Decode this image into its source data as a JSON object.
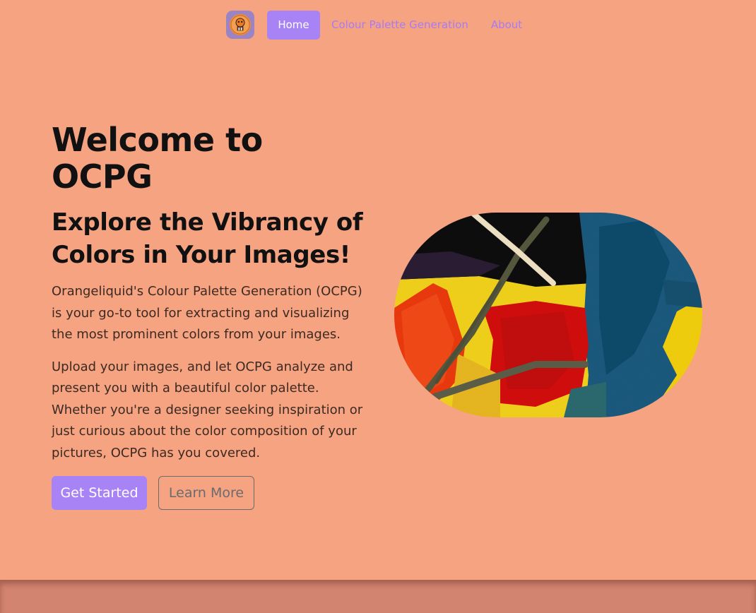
{
  "nav": {
    "logo_icon": "orange-mascot-icon",
    "items": [
      {
        "label": "Home",
        "active": true
      },
      {
        "label": "Colour Palette Generation",
        "active": false
      },
      {
        "label": "About",
        "active": false
      }
    ]
  },
  "hero": {
    "title": "Welcome to OCPG",
    "subtitle": "Explore the Vibrancy of Colors in Your Images!",
    "paragraph1": "Orangeliquid's Colour Palette Generation (OCPG) is your go-to tool for extracting and visualizing the most prominent colors from your images.",
    "paragraph2": "Upload your images, and let OCPG analyze and present you with a beautiful color palette. Whether you're a designer seeking inspiration or just curious about the color composition of your pictures, OCPG has you covered.",
    "primary_button": "Get Started",
    "secondary_button": "Learn More"
  },
  "colors": {
    "background": "#f6a382",
    "accent": "#a883f6",
    "footer": "#d38470"
  }
}
